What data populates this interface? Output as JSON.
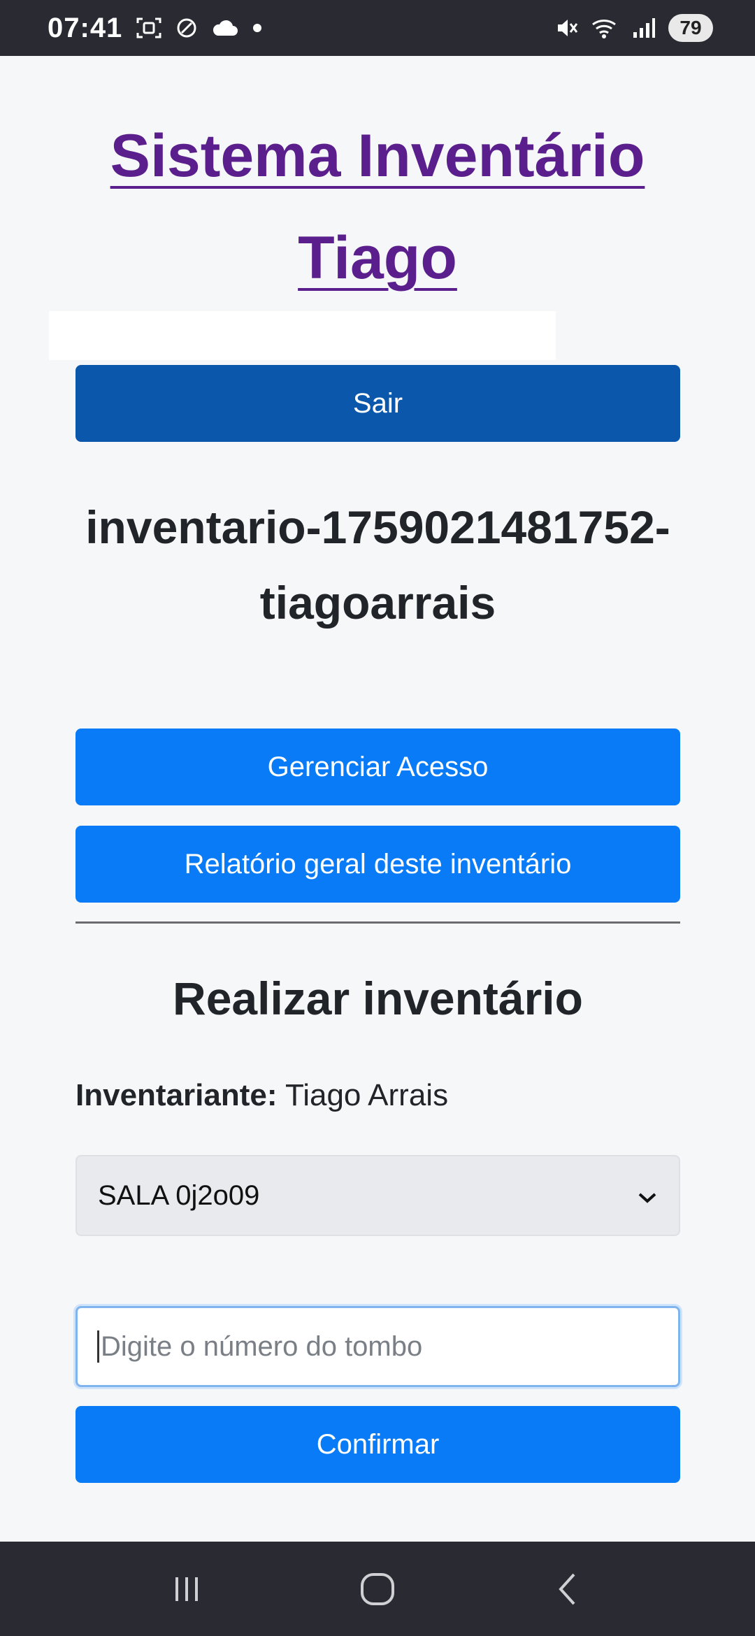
{
  "status_bar": {
    "time": "07:41",
    "battery": "79",
    "icons": [
      "screenshot-icon",
      "no-disturb-icon",
      "cloud-icon",
      "dot-icon",
      "mute-icon",
      "wifi-icon",
      "signal-icon",
      "battery-icon"
    ]
  },
  "header": {
    "title": "Sistema Inventário Tiago"
  },
  "actions": {
    "logout_label": "Sair"
  },
  "inventory": {
    "name": "inventario-1759021481752-tiagoarrais",
    "manage_access_label": "Gerenciar Acesso",
    "general_report_label": "Relatório geral deste inventário"
  },
  "perform": {
    "section_title": "Realizar inventário",
    "inventariante_label": "Inventariante:",
    "inventariante_name": "Tiago Arrais",
    "room_selected": "SALA 0j2o09",
    "tombo_placeholder": "Digite o número do tombo",
    "tombo_value": "",
    "confirm_label": "Confirmar"
  },
  "colors": {
    "title": "#5a1f8c",
    "logout_button": "#0a57ab",
    "primary_button": "#0a7bf7",
    "system_bar": "#2a2a33"
  }
}
